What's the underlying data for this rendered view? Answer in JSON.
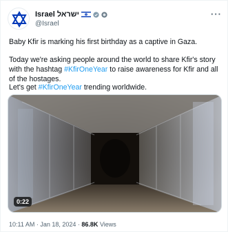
{
  "tweet": {
    "display_name": "Israel ישראל",
    "handle": "@Israel",
    "more_label": "···",
    "paragraph1": "Baby Kfir is marking his first birthday as a captive in Gaza.",
    "paragraph2_a": "Today we're asking people around the world to share Kfir's story with the hashtag ",
    "hashtag": "#KfirOneYear",
    "paragraph2_b": " to raise awareness for Kfir and all of the hostages.",
    "paragraph3_a": "Let's get ",
    "paragraph3_b": " trending worldwide.",
    "video_duration": "0:22",
    "timestamp": "10:11 AM · Jan 18, 2024 · ",
    "views_count": "86.8K",
    "views_label": " Views"
  },
  "icons": {
    "avatar": "star-of-david-icon",
    "flag": "israel-flag-icon",
    "badge1": "verified-badge-icon",
    "badge2": "government-badge-icon"
  },
  "colors": {
    "accent": "#1d9bf0",
    "text": "#0f1419",
    "secondary_text": "#536471",
    "flag_blue": "#0038b8"
  }
}
